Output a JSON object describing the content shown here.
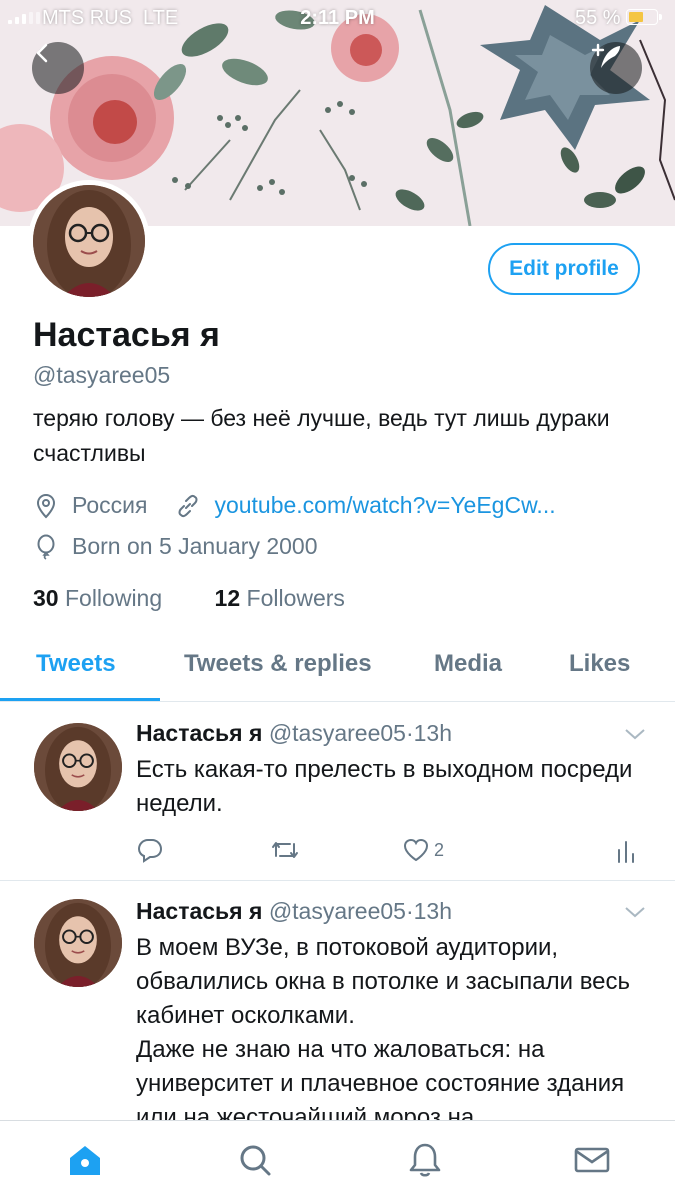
{
  "status_bar": {
    "carrier": "MTS RUS",
    "network": "LTE",
    "time": "2:11 PM",
    "battery": "55 %",
    "battery_level": 0.55
  },
  "profile": {
    "name": "Настасья я",
    "handle": "@tasyaree05",
    "bio": "теряю голову — без неё лучше, ведь тут лишь дураки счастливы",
    "location": "Россия",
    "link": "youtube.com/watch?v=YeEgCw...",
    "birthday": "Born on 5 January 2000",
    "following_count": "30",
    "following_label": "Following",
    "followers_count": "12",
    "followers_label": "Followers",
    "edit_label": "Edit profile"
  },
  "tabs": [
    {
      "label": "Tweets",
      "active": true
    },
    {
      "label": "Tweets & replies",
      "active": false
    },
    {
      "label": "Media",
      "active": false
    },
    {
      "label": "Likes",
      "active": false
    }
  ],
  "tweets": [
    {
      "name": "Настасья я",
      "handle": "@tasyaree05",
      "time": "13h",
      "text": "Есть какая-то прелесть в выходном посреди недели.",
      "likes": "2"
    },
    {
      "name": "Настасья я",
      "handle": "@tasyaree05",
      "time": "13h",
      "text": "В моем ВУЗе, в потоковой аудитории, обвалились окна в потолке и засыпали весь кабинет осколками.\nДаже не знаю на что жаловаться: на университет и плачевное состояние здания или на жесточайший мороз на"
    }
  ],
  "tab_bar": [
    "home-icon",
    "search-icon",
    "notifications-icon",
    "messages-icon"
  ],
  "colors": {
    "accent": "#1da1f2",
    "secondary_text": "#657786",
    "link": "#1b95e0"
  }
}
